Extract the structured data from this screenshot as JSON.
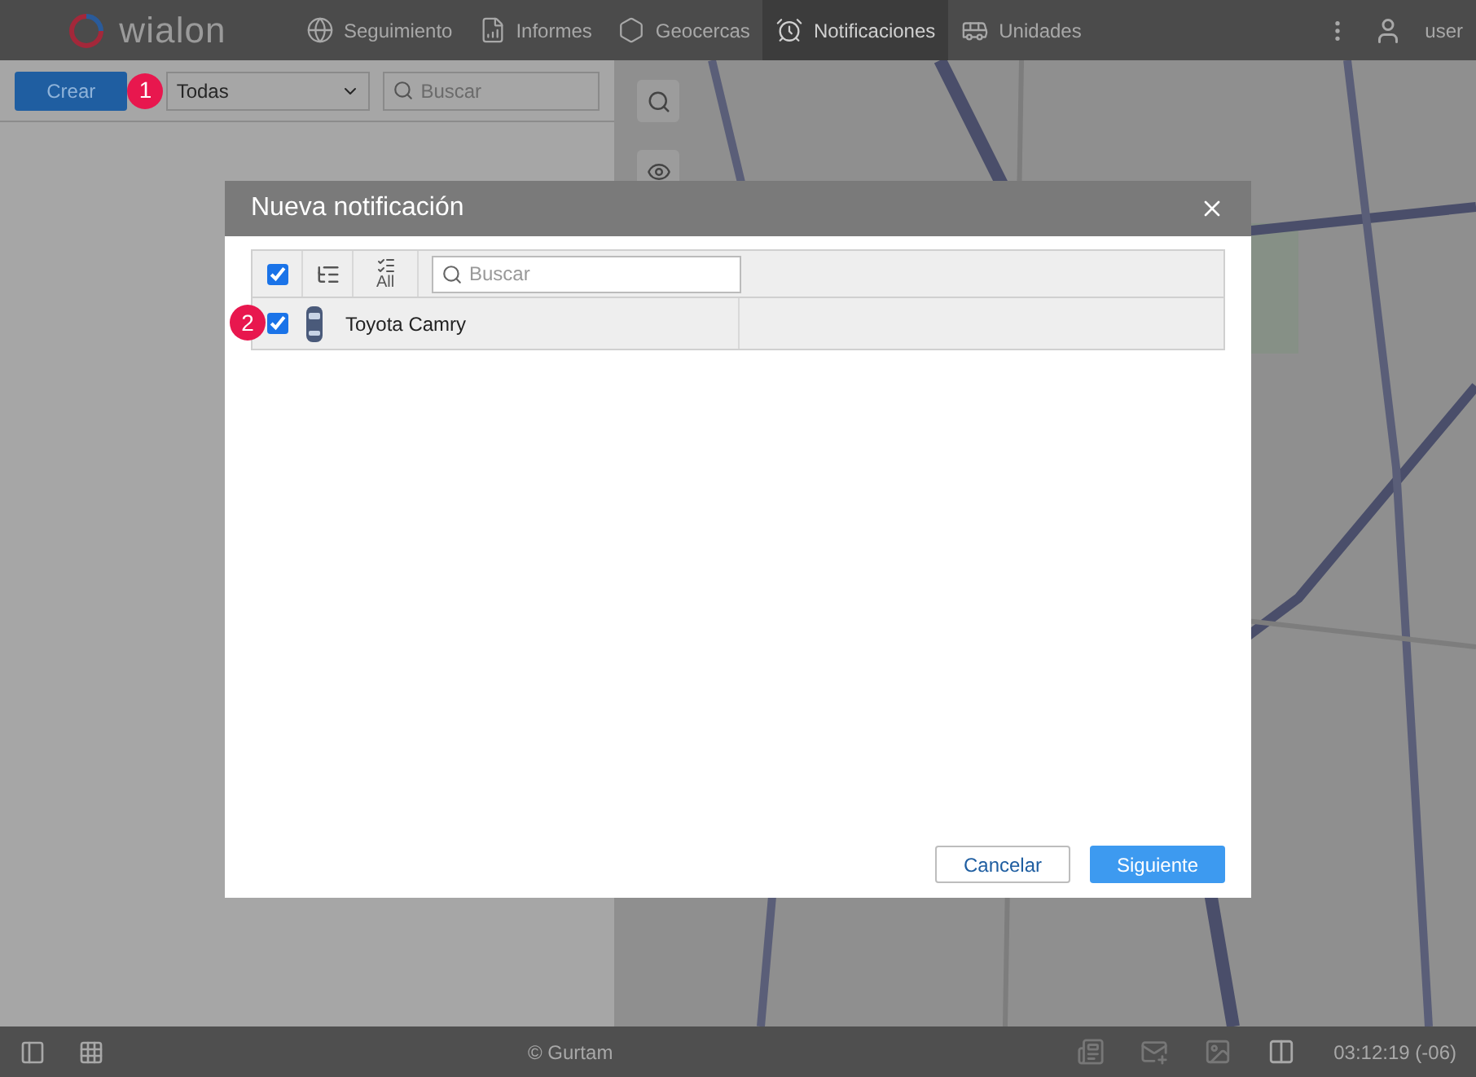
{
  "topbar": {
    "logo": "wialon",
    "nav": [
      {
        "label": "Seguimiento",
        "selected": false
      },
      {
        "label": "Informes",
        "selected": false
      },
      {
        "label": "Geocercas",
        "selected": false
      },
      {
        "label": "Notificaciones",
        "selected": true
      },
      {
        "label": "Unidades",
        "selected": false
      }
    ],
    "user": "user"
  },
  "panel": {
    "create_button": "Crear",
    "filter": "Todas",
    "search_placeholder": "Buscar"
  },
  "markers": [
    "1",
    "2"
  ],
  "dialog": {
    "title": "Nueva notificación",
    "select_all_checked": true,
    "all_label": "All",
    "search_placeholder": "Buscar",
    "units": [
      {
        "name": "Toyota Camry",
        "checked": true
      }
    ],
    "cancel": "Cancelar",
    "next": "Siguiente"
  },
  "status_bar": {
    "copyright": "© Gurtam",
    "time": "03:12:19 (-06)"
  }
}
